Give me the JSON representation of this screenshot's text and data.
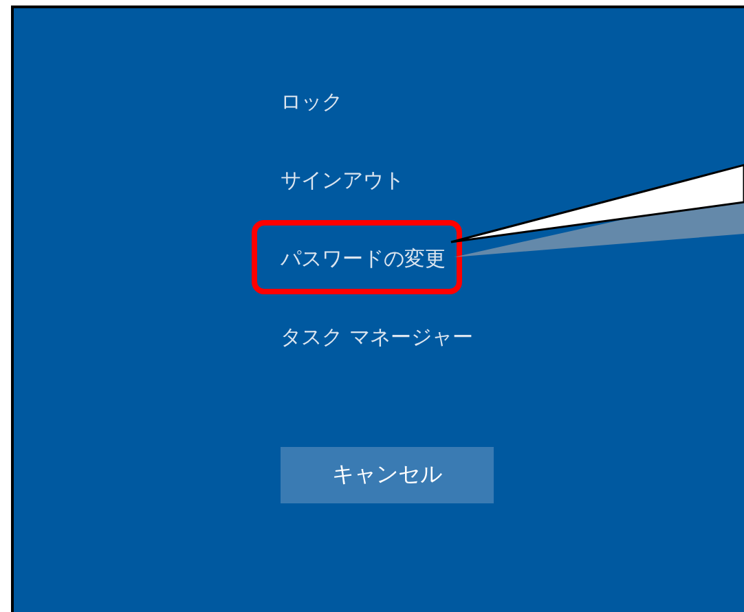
{
  "menu_items": [
    {
      "label": "ロック",
      "highlighted": false
    },
    {
      "label": "サインアウト",
      "highlighted": false
    },
    {
      "label": "パスワードの変更",
      "highlighted": true
    },
    {
      "label": "タスク マネージャー",
      "highlighted": false
    }
  ],
  "cancel_button": {
    "label": "キャンセル"
  }
}
